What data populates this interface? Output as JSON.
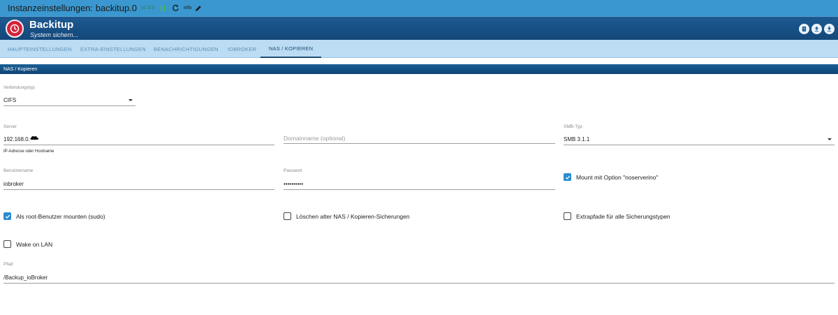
{
  "topbar": {
    "title": "Instanzeinstellungen: backitup.0",
    "version": "v2.9.5",
    "info_label": "info"
  },
  "header": {
    "adapter_name": "Backitup",
    "subtitle": "System sichern..."
  },
  "tabs": [
    {
      "label": "HAUPTEINSTELLUNGEN",
      "active": false
    },
    {
      "label": "EXTRA-EINSTELLUNGEN",
      "active": false
    },
    {
      "label": "BENACHRICHTIGUNGEN",
      "active": false
    },
    {
      "label": "IOBROKER",
      "active": false
    },
    {
      "label": "NAS / KOPIEREN",
      "active": true
    }
  ],
  "section": {
    "title": "NAS / Kopieren"
  },
  "form": {
    "connection_type": {
      "label": "Verbindungstyp",
      "value": "CIFS"
    },
    "server": {
      "label": "Server",
      "value": "192.168.0.",
      "helper": "IP-Adresse oder Hostname"
    },
    "domain": {
      "placeholder": "Domainname (optional)"
    },
    "smb_type": {
      "label": "SMB-Typ",
      "value": "SMB 3.1.1"
    },
    "username": {
      "label": "Benutzername",
      "value": "iobroker"
    },
    "password": {
      "label": "Passwort",
      "value": "••••••••••"
    },
    "noserverino": {
      "label": "Mount mit Option \"noserverino\"",
      "checked": true
    },
    "sudo": {
      "label": "Als root-Benutzer mounten (sudo)",
      "checked": true
    },
    "delete_old": {
      "label": "Löschen alter NAS / Kopieren-Sicherungen",
      "checked": false
    },
    "extra_paths": {
      "label": "Extrapfade für alle Sicherungstypen",
      "checked": false
    },
    "wake_on_lan": {
      "label": "Wake on LAN",
      "checked": false
    },
    "path": {
      "label": "Pfad",
      "value": "/Backup_ioBroker"
    }
  }
}
